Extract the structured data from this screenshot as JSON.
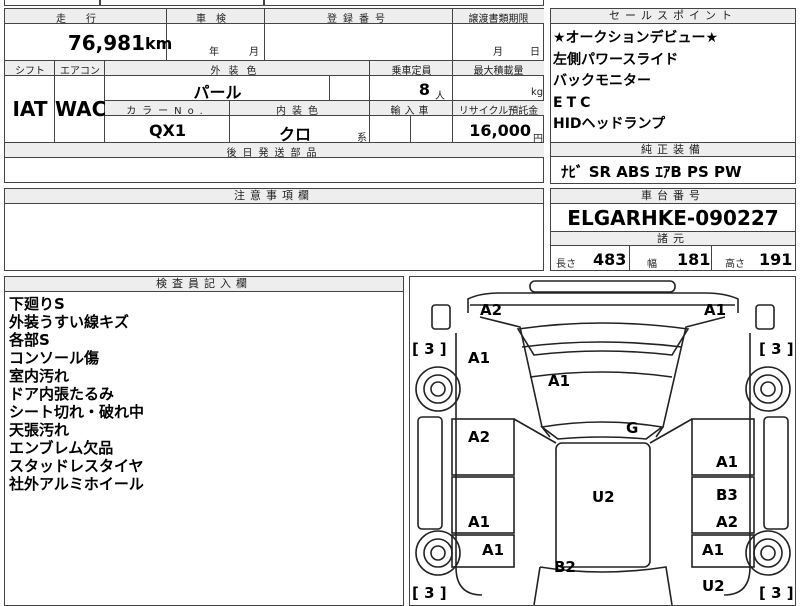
{
  "top": {
    "cell1": "",
    "cell2": "",
    "cell3": ""
  },
  "mileage": {
    "label": "走行",
    "value": "76,981",
    "unit": "km"
  },
  "shaken": {
    "label": "車検",
    "year_unit": "年",
    "month_unit": "月"
  },
  "registration": {
    "label": "登録番号",
    "value": ""
  },
  "transfer": {
    "label": "譲渡書類期限",
    "month_unit": "月",
    "day_unit": "日"
  },
  "shift": {
    "label": "シフト",
    "value": "IAT"
  },
  "aircon": {
    "label": "エアコン",
    "value": "WAC"
  },
  "exterior": {
    "label": "外装色",
    "value": "パール"
  },
  "capacity": {
    "label": "乗車定員",
    "value": "8",
    "unit": "人"
  },
  "max_load": {
    "label": "最大積載量",
    "unit": "kg"
  },
  "color_no": {
    "label": "カラーNo.",
    "value": "QX1"
  },
  "interior": {
    "label": "内装色",
    "value": "クロ",
    "suffix": "系"
  },
  "import": {
    "label": "輸入車"
  },
  "recycle": {
    "label": "リサイクル預託金",
    "value": "16,000",
    "unit": "円"
  },
  "later_parts": {
    "label": "後日発送部品"
  },
  "caution": {
    "label": "注意事項欄"
  },
  "sales_points": {
    "label": "セールスポイント",
    "items": [
      "★オークションデビュー★",
      "左側パワースライド",
      "バックモニター",
      "ETC",
      "HIDヘッドランプ"
    ]
  },
  "equipment": {
    "label": "純正装備",
    "value": "ﾅﾋﾞ SR ABS ｴｱB PS PW"
  },
  "chassis": {
    "label": "車台番号",
    "value": "ELGARHKE-090227"
  },
  "dimensions": {
    "label": "諸元",
    "length_label": "長さ",
    "length": "483",
    "width_label": "幅",
    "width": "181",
    "height_label": "高さ",
    "height": "191"
  },
  "inspector": {
    "label": "検査員記入欄",
    "notes": [
      "下廻りS",
      "外装うすい線キズ",
      "各部S",
      "コンソール傷",
      "室内汚れ",
      "ドア内張たるみ",
      "シート切れ・破れ中",
      "天張汚れ",
      "エンブレム欠品",
      "スタッドレスタイヤ",
      "社外アルミホイール"
    ]
  },
  "diagram": {
    "tire_bracket": "[ 3 ]",
    "marks": {
      "front_left": "A2",
      "front_right": "A1",
      "fender_left": "A1",
      "hood": "A1",
      "windshield": "G",
      "door_left_front": "A2",
      "door_right_front": "A1",
      "roof": "U2",
      "door_right_rear": "B3",
      "door_left_rear": "A1",
      "door_right_rear2": "A2",
      "quarter_left": "A1",
      "quarter_right": "A1",
      "back_door": "B2",
      "rear_right": "U2"
    }
  }
}
